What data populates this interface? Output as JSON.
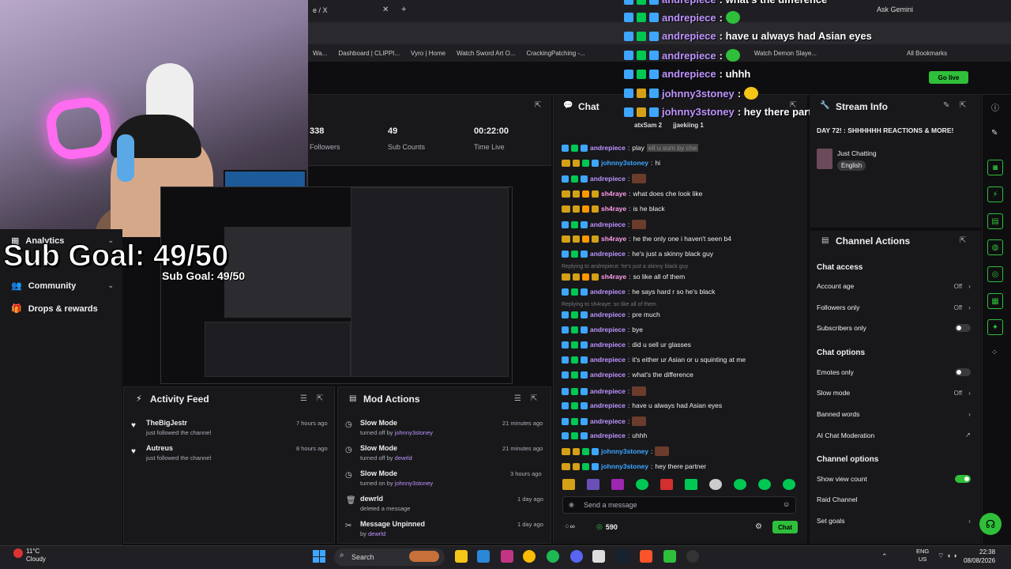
{
  "browser": {
    "tab_title": "e / X",
    "ask_gemini": "Ask Gemini",
    "bookmarks": [
      "Wa...",
      "Dashboard | CLIPPI...",
      "Vyro | Home",
      "Watch Sword Art O...",
      "CrackingPatching -...",
      "Watch Demon Slaye..."
    ],
    "all_bookmarks": "All Bookmarks"
  },
  "header": {
    "go_live": "Go live"
  },
  "sidebar": {
    "items": [
      {
        "label": "Analytics"
      },
      {
        "label": "Community"
      },
      {
        "label": "Drops & rewards"
      }
    ]
  },
  "overlay": {
    "sub_goal": "Sub Goal: 49/50",
    "sub_goal_small": "Sub Goal: 49/50",
    "chat": [
      {
        "user": "andrepiece",
        "text": ": what's the difference"
      },
      {
        "user": "andrepiece",
        "text": ":"
      },
      {
        "user": "andrepiece",
        "text": ": have u always had Asian eyes"
      },
      {
        "user": "andrepiece",
        "text": ":"
      },
      {
        "user": "andrepiece",
        "text": ": uhhh"
      },
      {
        "user": "johnny3stoney",
        "text": ":"
      },
      {
        "user": "johnny3stoney",
        "text": ": hey there partner"
      }
    ],
    "viewers": [
      "atxSam 2",
      "jjaekiing 1"
    ]
  },
  "stats": [
    {
      "value": "338",
      "label": "Followers"
    },
    {
      "value": "49",
      "label": "Sub Counts"
    },
    {
      "value": "00:22:00",
      "label": "Time Live"
    }
  ],
  "activity_feed": {
    "title": "Activity Feed",
    "items": [
      {
        "who": "TheBigJestr",
        "what": "just followed the channel",
        "time": "7 hours ago"
      },
      {
        "who": "Autreus",
        "what": "just followed the channel",
        "time": "8 hours ago"
      }
    ]
  },
  "mod_actions": {
    "title": "Mod Actions",
    "items": [
      {
        "action": "Slow Mode",
        "detail": "turned off by",
        "by": "johnny3stoney",
        "time": "21 minutes ago"
      },
      {
        "action": "Slow Mode",
        "detail": "turned off by",
        "by": "dewrld",
        "time": "21 minutes ago"
      },
      {
        "action": "Slow Mode",
        "detail": "turned on by",
        "by": "johnny3stoney",
        "time": "3 hours ago"
      },
      {
        "action": "dewrld",
        "detail": "deleted a message",
        "by": "",
        "time": "1 day ago"
      },
      {
        "action": "Message Unpinned",
        "detail": "by",
        "by": "dewrld",
        "time": "1 day ago"
      }
    ]
  },
  "chat": {
    "title": "Chat",
    "messages": [
      {
        "user": "andrepiece",
        "text": "play",
        "extra": "ell u sum by che"
      },
      {
        "user": "johnny3stoney",
        "text": "hi"
      },
      {
        "user": "andrepiece",
        "text": ""
      },
      {
        "user": "sh4raye",
        "text": "what does che look like"
      },
      {
        "user": "sh4raye",
        "text": "is he black"
      },
      {
        "user": "andrepiece",
        "text": ""
      },
      {
        "user": "sh4raye",
        "text": "he the only one i haven't seen b4"
      },
      {
        "user": "andrepiece",
        "text": "he's just a skinny black guy"
      },
      {
        "user": "sh4raye",
        "text": "so like all of them"
      },
      {
        "user": "andrepiece",
        "text": "he says hard r so he's black"
      },
      {
        "user": "andrepiece",
        "text": "pre much"
      },
      {
        "user": "andrepiece",
        "text": "bye"
      },
      {
        "user": "andrepiece",
        "text": "did u sell ur glasses"
      },
      {
        "user": "andrepiece",
        "text": "it's either ur Asian or u squinting at me"
      },
      {
        "user": "andrepiece",
        "text": "what's the difference"
      },
      {
        "user": "andrepiece",
        "text": ""
      },
      {
        "user": "andrepiece",
        "text": "have u always had Asian eyes"
      },
      {
        "user": "andrepiece",
        "text": ""
      },
      {
        "user": "andrepiece",
        "text": "uhhh"
      },
      {
        "user": "johnny3stoney",
        "text": ""
      },
      {
        "user": "johnny3stoney",
        "text": "hey there partner"
      }
    ],
    "reply1": "Replying to andrepiece: he's just a skinny black guy",
    "reply2": "Replying to sh4raye: so like all of them",
    "placeholder": "Send a message",
    "points": "590",
    "send": "Chat"
  },
  "stream_info": {
    "title": "Stream Info",
    "stream_title": "DAY 72! : SHHHHHH REACTIONS & MORE!",
    "category": "Just Chatting",
    "language": "English"
  },
  "channel_actions": {
    "title": "Channel Actions",
    "chat_access": "Chat access",
    "account_age": {
      "label": "Account age",
      "value": "Off"
    },
    "followers_only": {
      "label": "Followers only",
      "value": "Off"
    },
    "subscribers_only": {
      "label": "Subscribers only"
    },
    "chat_options": "Chat options",
    "emotes_only": {
      "label": "Emotes only"
    },
    "slow_mode": {
      "label": "Slow mode",
      "value": "Off"
    },
    "banned_words": {
      "label": "Banned words"
    },
    "ai_mod": {
      "label": "AI Chat Moderation"
    },
    "channel_options": "Channel options",
    "show_view_count": {
      "label": "Show view count",
      "on": true
    },
    "raid_channel": {
      "label": "Raid Channel"
    },
    "set_goals": {
      "label": "Set goals"
    }
  },
  "taskbar": {
    "weather_temp": "11°C",
    "weather_desc": "Cloudy",
    "search": "Search",
    "lang": "ENG",
    "region": "US",
    "time": "22:38",
    "date": "08/08/2026"
  }
}
